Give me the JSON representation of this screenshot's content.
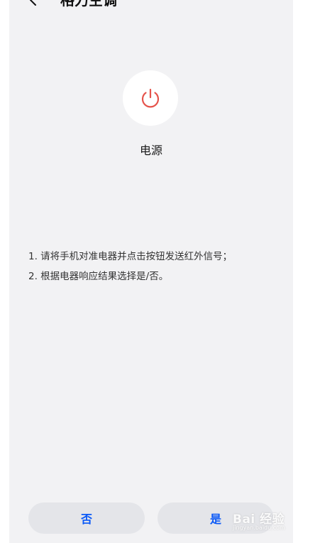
{
  "header": {
    "title": "格力空调"
  },
  "power": {
    "label": "电源"
  },
  "instructions": [
    "1. 请将手机对准电器并点击按钮发送红外信号；",
    "2. 根据电器响应结果选择是/否。"
  ],
  "buttons": {
    "no_label": "否",
    "yes_label": "是"
  },
  "watermark": {
    "main": "Bai 经验",
    "sub": "jingyan.baidu.com"
  },
  "colors": {
    "accent": "#0a59f7",
    "power_icon": "#e5534b",
    "background": "#f2f2f4"
  },
  "icons": {
    "back": "back-arrow-icon",
    "power": "power-icon"
  }
}
